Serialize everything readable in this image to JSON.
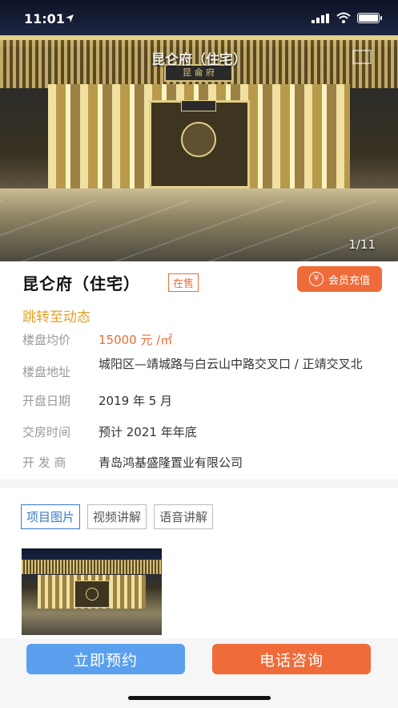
{
  "status_bar": {
    "time": "11:01"
  },
  "hero": {
    "overlay_title": "昆仑府（住宅）",
    "sign_text": "昆 侖 府",
    "counter": "1/11"
  },
  "property": {
    "name": "昆仑府（住宅）",
    "sale_status": "在售",
    "vip_button": "会员充值",
    "vip_icon": "￥",
    "jump_link": "跳转至动态"
  },
  "info": [
    {
      "label": "楼盘均价",
      "value": "15000 元 /㎡"
    },
    {
      "label": "楼盘地址",
      "value": "城阳区—靖城路与白云山中路交叉口 / 正靖交叉北"
    },
    {
      "label": "开盘日期",
      "value": "2019 年 5 月"
    },
    {
      "label": "交房时间",
      "value": "预计 2021 年年底"
    },
    {
      "label": "开 发 商",
      "value": "青岛鸿基盛隆置业有限公司"
    }
  ],
  "tabs": [
    {
      "label": "项目图片",
      "active": true
    },
    {
      "label": "视频讲解",
      "active": false
    },
    {
      "label": "语音讲解",
      "active": false
    }
  ],
  "actions": {
    "book": "立即预约",
    "call": "电话咨询"
  },
  "colors": {
    "accent": "#ef6c3a",
    "link": "#e3a22a",
    "tab_active": "#3a79c9",
    "book_button": "#5ba0ee"
  }
}
